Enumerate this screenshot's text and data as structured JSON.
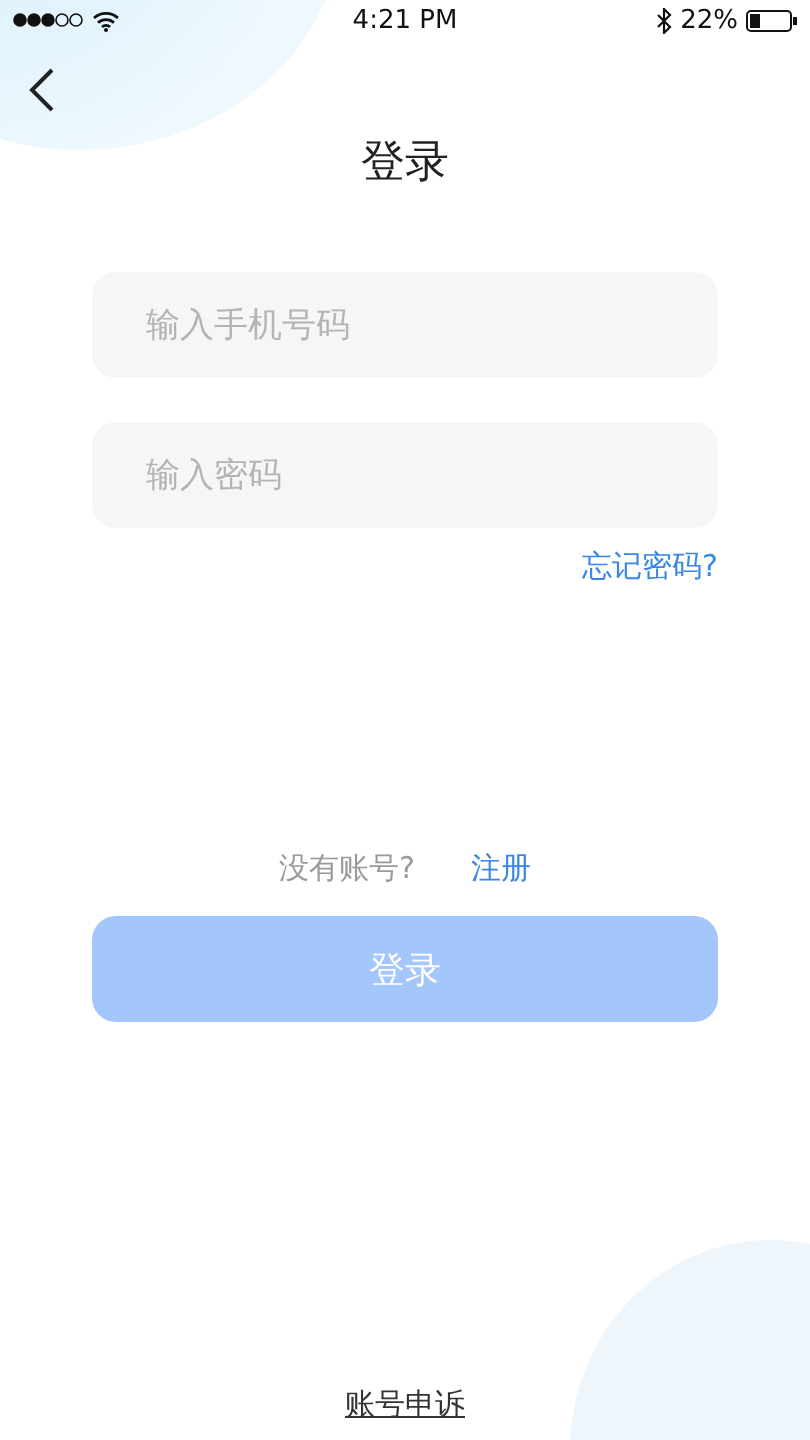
{
  "status_bar": {
    "time": "4:21 PM",
    "battery": "22%"
  },
  "title": "登录",
  "fields": [
    {
      "placeholder": "输入手机号码"
    },
    {
      "placeholder": "输入密码"
    }
  ],
  "forgot_link": "忘记密码?",
  "signup": {
    "prompt": "没有账号?",
    "link": "注册"
  },
  "login_button": {
    "label": "登录",
    "disabled": true
  },
  "appeal_link": "账号申诉"
}
